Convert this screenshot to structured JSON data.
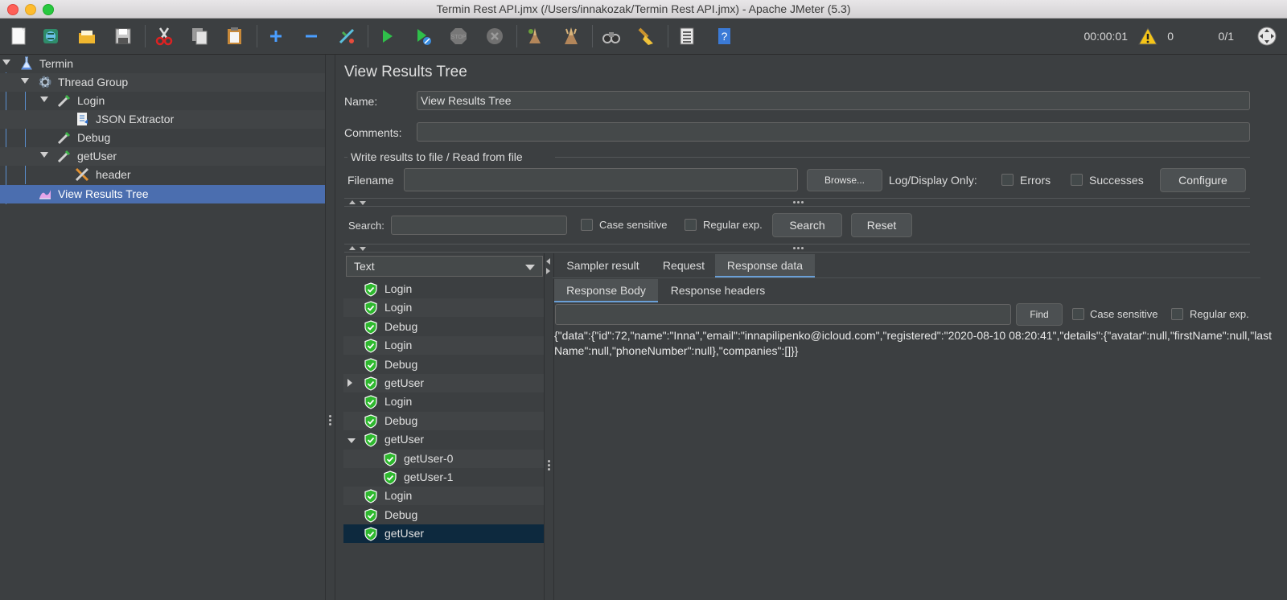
{
  "window": {
    "title": "Termin Rest API.jmx (/Users/innakozak/Termin Rest API.jmx) - Apache JMeter (5.3)"
  },
  "toolbar": {
    "items": [
      "new-icon",
      "templates-icon",
      "open-icon",
      "save-icon",
      "cut-icon",
      "copy-icon",
      "paste-icon",
      "expand-icon",
      "collapse-icon",
      "toggle-icon",
      "start-icon",
      "start-no-pauses-icon",
      "stop-icon",
      "shutdown-icon",
      "clear-icon",
      "clear-all-icon",
      "search-icon",
      "reset-search-icon",
      "function-helper-icon",
      "help-icon"
    ],
    "elapsed": "00:00:01",
    "warnings": "0",
    "threads": "0/1"
  },
  "tree": {
    "nodes": [
      {
        "label": "Termin",
        "icon": "test-plan-icon"
      },
      {
        "label": "Thread Group",
        "icon": "gear-icon"
      },
      {
        "label": "Login",
        "icon": "sampler-icon"
      },
      {
        "label": "JSON Extractor",
        "icon": "extractor-icon"
      },
      {
        "label": "Debug",
        "icon": "sampler-icon"
      },
      {
        "label": "getUser",
        "icon": "sampler-icon"
      },
      {
        "label": "header",
        "icon": "tools-icon"
      },
      {
        "label": "View Results Tree",
        "icon": "listener-icon"
      }
    ]
  },
  "panel": {
    "title": "View Results Tree",
    "name_label": "Name:",
    "name_value": "View Results Tree",
    "comments_label": "Comments:",
    "comments_value": "",
    "file_group_title": "Write results to file / Read from file",
    "filename_label": "Filename",
    "filename_value": "",
    "browse_label": "Browse...",
    "log_display_label": "Log/Display Only:",
    "errors_label": "Errors",
    "successes_label": "Successes",
    "configure_label": "Configure"
  },
  "search": {
    "label": "Search:",
    "value": "",
    "case_sensitive_label": "Case sensitive",
    "regex_label": "Regular exp.",
    "search_button": "Search",
    "reset_button": "Reset"
  },
  "results": {
    "renderer": "Text",
    "items": [
      {
        "label": "Login",
        "status": "success"
      },
      {
        "label": "Login",
        "status": "success"
      },
      {
        "label": "Debug",
        "status": "success"
      },
      {
        "label": "Login",
        "status": "success"
      },
      {
        "label": "Debug",
        "status": "success"
      },
      {
        "label": "getUser",
        "status": "success",
        "expandable": "collapsed"
      },
      {
        "label": "Login",
        "status": "success"
      },
      {
        "label": "Debug",
        "status": "success"
      },
      {
        "label": "getUser",
        "status": "success",
        "expandable": "expanded"
      },
      {
        "label": "getUser-0",
        "status": "success"
      },
      {
        "label": "getUser-1",
        "status": "success"
      },
      {
        "label": "Login",
        "status": "success"
      },
      {
        "label": "Debug",
        "status": "success"
      },
      {
        "label": "getUser",
        "status": "success",
        "selected": "true"
      }
    ]
  },
  "detail": {
    "tabs": [
      "Sampler result",
      "Request",
      "Response data"
    ],
    "active_tab": "Response data",
    "subtabs": [
      "Response Body",
      "Response headers"
    ],
    "active_subtab": "Response Body",
    "find_value": "",
    "find_button": "Find",
    "case_sensitive_label": "Case sensitive",
    "regex_label": "Regular exp.",
    "response_body": "{\"data\":{\"id\":72,\"name\":\"Inna\",\"email\":\"innapilipenko@icloud.com\",\"registered\":\"2020-08-10 08:20:41\",\"details\":{\"avatar\":null,\"firstName\":null,\"lastName\":null,\"phoneNumber\":null},\"companies\":[]}}"
  },
  "colors": {
    "background": "#3c3f41",
    "selection": "#4b6eaf",
    "success": "#2eb82e",
    "result_selection": "#0d293e"
  }
}
